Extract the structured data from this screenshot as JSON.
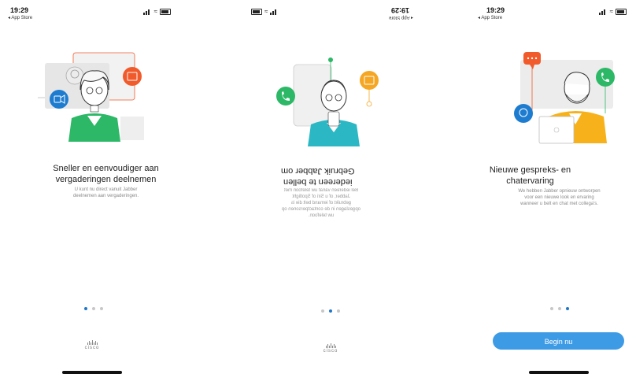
{
  "screens": [
    {
      "status": {
        "time": "19:29",
        "back": "◂ App Store"
      },
      "title_line1": "Sneller en eenvoudiger aan",
      "title_line2": "vergaderingen deelnemen",
      "desc_line1": "U kunt nu direct vanuit Jabber",
      "desc_line2": "deelnemen aan vergaderingen.",
      "pager": {
        "active": 1,
        "total": 3
      },
      "logo": "cisco"
    },
    {
      "status": {
        "time": "19:29",
        "back": "◂ App Store"
      },
      "title_line1": "Gebruik Jabber om",
      "title_line2": "iedereen te bellen",
      "desc_lines": [
        "Bel iedereen vanaf uw telefoon met",
        "Jabber, of u Siri of Spotlight",
        "gebruikt of iemand belt die is",
        "opgeslagen in de contactpersonen op",
        "uw telefoon."
      ],
      "pager": {
        "active": 2,
        "total": 3
      },
      "logo": "cisco"
    },
    {
      "status": {
        "time": "19:29",
        "back": "◂ App Store"
      },
      "title_line1": "Nieuwe gespreks- en",
      "title_line2": "chatervaring",
      "desc_lines": [
        "We hebben Jabber opnieuw ontworpen",
        "voor een nieuwe look en ervaring",
        "wanneer u belt en chat met collega's."
      ],
      "pager": {
        "active": 3,
        "total": 3
      },
      "button_label": "Begin nu"
    }
  ],
  "colors": {
    "accent_blue": "#1f76c9",
    "button": "#3d9be6",
    "teal": "#2bb8c4",
    "green": "#2cb866",
    "orange": "#f5a623",
    "red_orange": "#f15a2b",
    "yellow": "#f7b21b"
  },
  "icons": [
    "video-icon",
    "phone-icon",
    "chat-icon",
    "mail-icon",
    "signal-icon",
    "wifi-icon",
    "battery-icon"
  ]
}
